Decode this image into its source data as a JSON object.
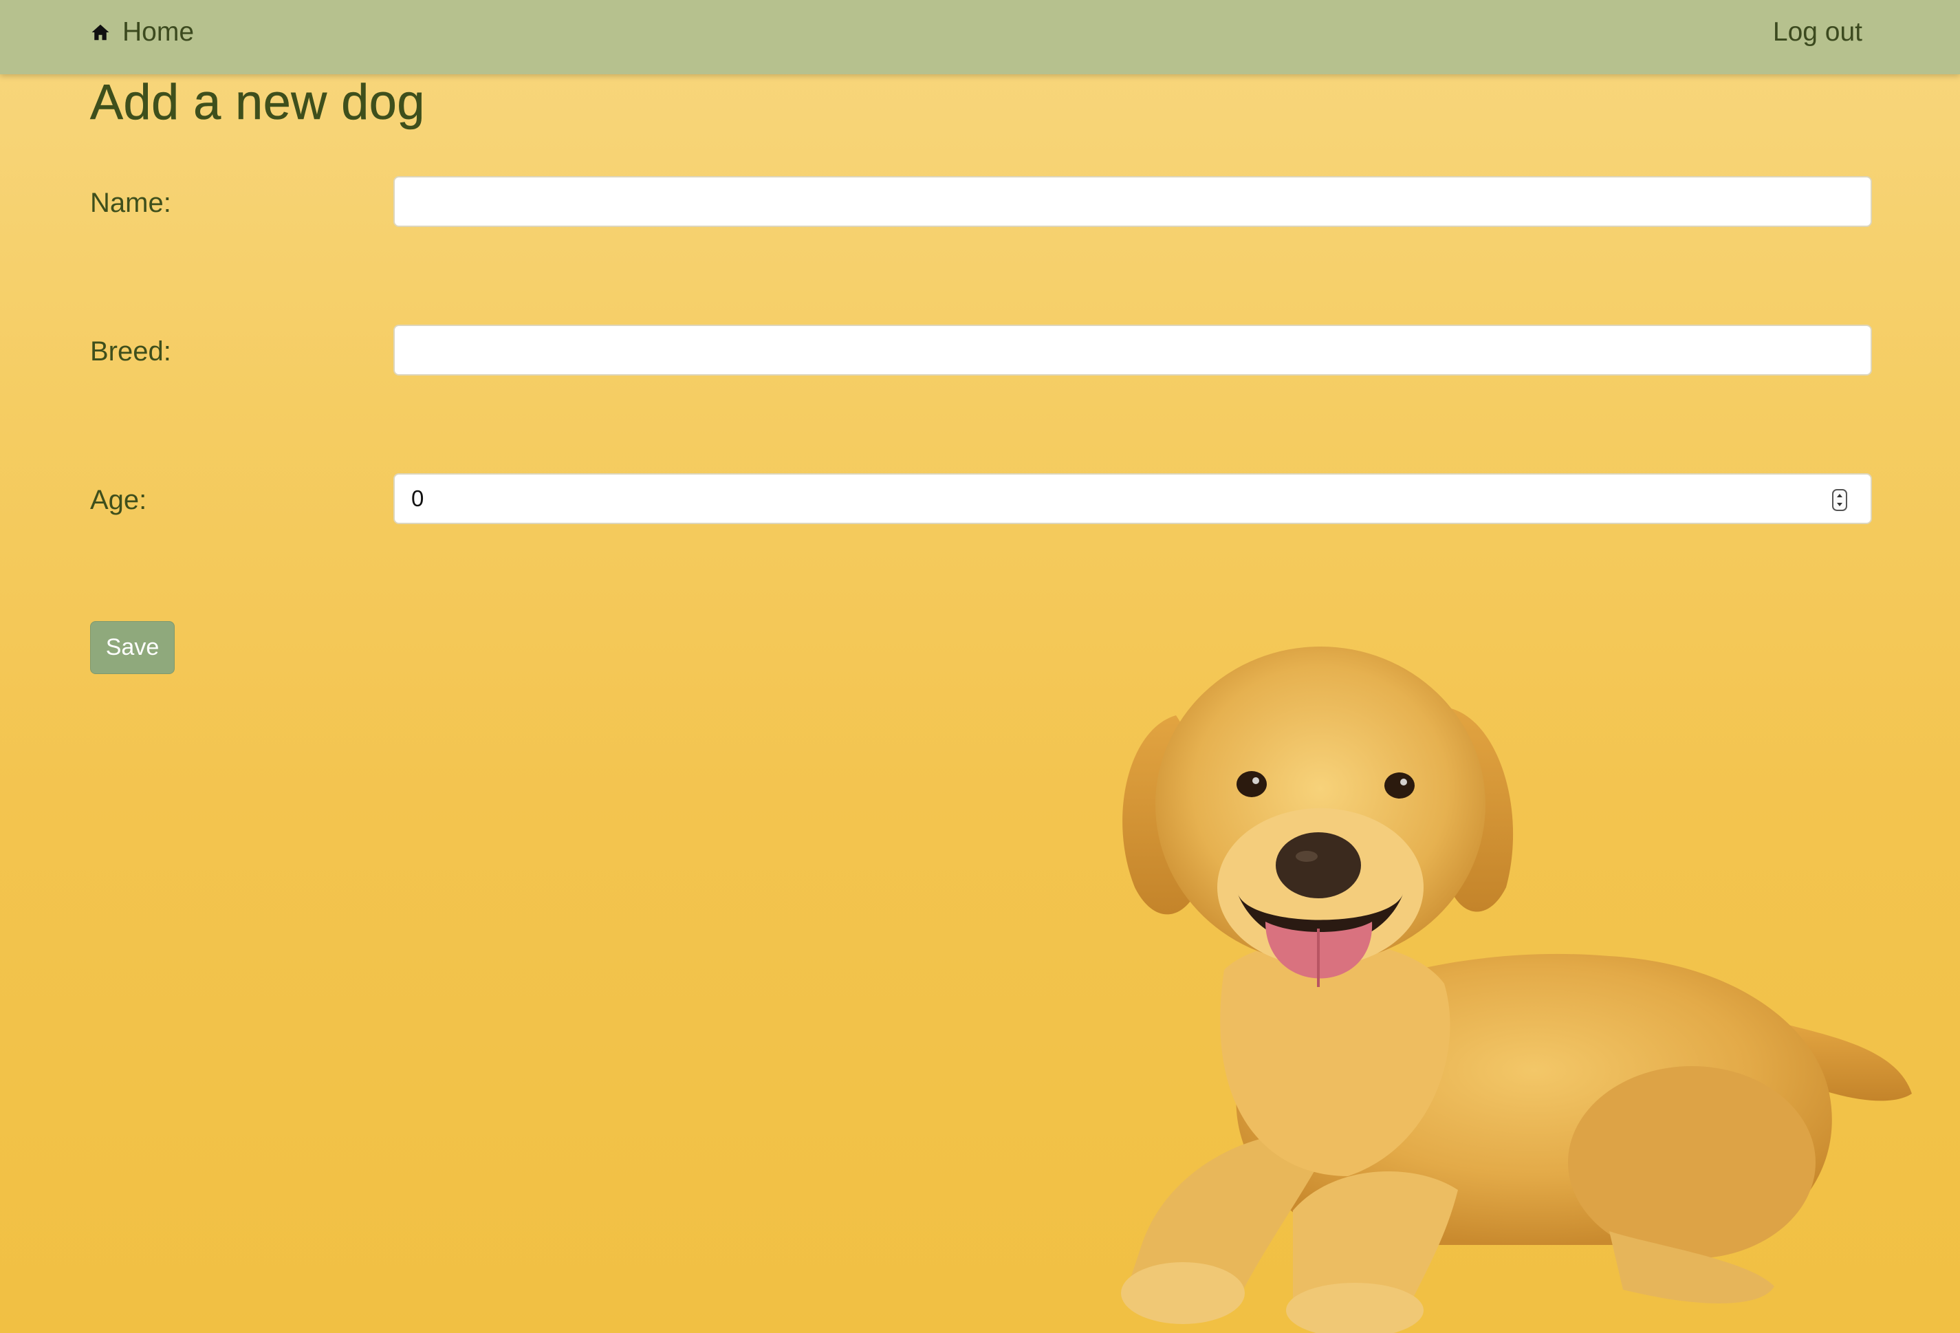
{
  "nav": {
    "home_label": "Home",
    "logout_label": "Log out"
  },
  "page": {
    "title": "Add a new dog"
  },
  "form": {
    "name": {
      "label": "Name:",
      "value": ""
    },
    "breed": {
      "label": "Breed:",
      "value": ""
    },
    "age": {
      "label": "Age:",
      "value": "0"
    },
    "save_label": "Save"
  },
  "icons": {
    "home": "home-icon",
    "spinner": "number-spinner-icon"
  },
  "colors": {
    "navbar": "#b6c18e",
    "background": "#f5cd63",
    "text": "#3e4f1c",
    "save_button": "#8fa97c"
  }
}
